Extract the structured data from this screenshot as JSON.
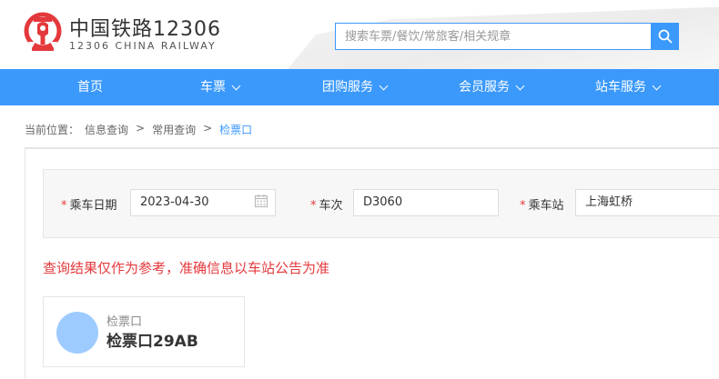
{
  "brand": {
    "name_cn": "中国铁路12306",
    "name_en": "12306 CHINA RAILWAY"
  },
  "search": {
    "placeholder": "搜索车票/餐饮/常旅客/相关规章"
  },
  "nav": [
    {
      "label": "首页"
    },
    {
      "label": "车票"
    },
    {
      "label": "团购服务"
    },
    {
      "label": "会员服务"
    },
    {
      "label": "站车服务"
    }
  ],
  "breadcrumb": {
    "prefix": "当前位置：",
    "items": [
      "信息查询",
      "常用查询",
      "检票口"
    ],
    "separator": ">"
  },
  "form": {
    "required_mark": "*",
    "date": {
      "label": "乘车日期",
      "value": "2023-04-30"
    },
    "train": {
      "label": "车次",
      "value": "D3060"
    },
    "station": {
      "label": "乘车站",
      "value": "上海虹桥"
    }
  },
  "notice": "查询结果仅作为参考，准确信息以车站公告为准",
  "result": {
    "label": "检票口",
    "value": "检票口29AB"
  },
  "colors": {
    "primary": "#3b99fc",
    "alert": "#e4393c",
    "brand_red": "#e4393c",
    "avatar": "#9ecbff"
  }
}
